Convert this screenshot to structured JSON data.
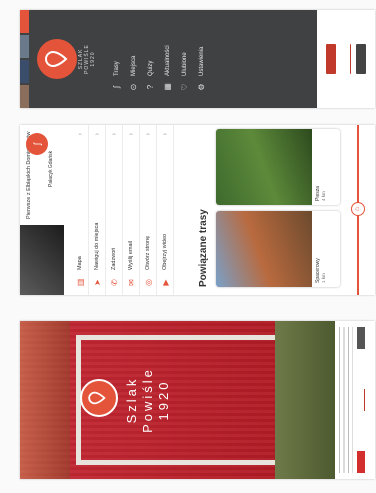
{
  "menu": {
    "title_lines": [
      "SZLAK",
      "POWIŚLE",
      "1920"
    ],
    "items": [
      {
        "label": "Trasy",
        "icon": "route-icon"
      },
      {
        "label": "Miejsca",
        "icon": "place-icon"
      },
      {
        "label": "Quizy",
        "icon": "quiz-icon"
      },
      {
        "label": "Aktualności",
        "icon": "news-icon"
      },
      {
        "label": "Ulubione",
        "icon": "heart-icon"
      },
      {
        "label": "Ustawienia",
        "icon": "settings-icon"
      }
    ]
  },
  "trails": {
    "header_card": "Pierwsze z Elbląskich Dominikanów",
    "second_card": "Pałacyk Gdańsk",
    "actions": [
      {
        "label": "Mapa",
        "icon": "map-icon"
      },
      {
        "label": "Nawiguj do miejsca",
        "icon": "navigate-icon"
      },
      {
        "label": "Zadzwoń",
        "icon": "phone-icon"
      },
      {
        "label": "Wyślij email",
        "icon": "email-icon"
      },
      {
        "label": "Otwórz stronę",
        "icon": "globe-icon"
      },
      {
        "label": "Obejrzyj wideo",
        "icon": "video-icon"
      }
    ],
    "section_title": "Powiązane trasy",
    "cards": [
      {
        "title": "Spacerowy",
        "meta": "1 km"
      },
      {
        "title": "Piesza",
        "meta": "4 km"
      }
    ]
  },
  "title_screen": {
    "title_lines": [
      "Szlak",
      "Powiśle",
      "1920"
    ]
  },
  "colors": {
    "accent": "#e4543a",
    "menu_bg": "#3f4143",
    "flag_red": "#b91e2b"
  }
}
